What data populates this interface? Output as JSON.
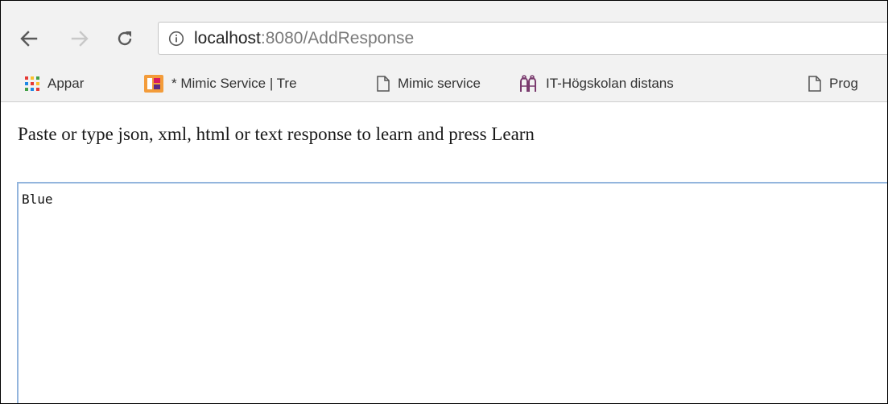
{
  "browser": {
    "url_host": "localhost",
    "url_rest": ":8080/AddResponse"
  },
  "bookmarks": [
    {
      "label": "Appar",
      "icon": "apps-grid-icon"
    },
    {
      "label": "* Mimic Service | Tre",
      "icon": "mimic-service-favicon"
    },
    {
      "label": "Mimic service",
      "icon": "page-icon"
    },
    {
      "label": "IT-Högskolan distans",
      "icon": "ithogskolan-favicon"
    },
    {
      "label": "Prog",
      "icon": "page-icon"
    }
  ],
  "page": {
    "instructions": "Paste or type json, xml, html or text response to learn and press Learn",
    "response_value": "Blue"
  },
  "colors": {
    "toolbar_bg": "#f2f2f2",
    "textarea_focus_border": "#93b5dd",
    "apps_icon": [
      "#e53935",
      "#fbc02d",
      "#43a047",
      "#1e88e5"
    ]
  }
}
